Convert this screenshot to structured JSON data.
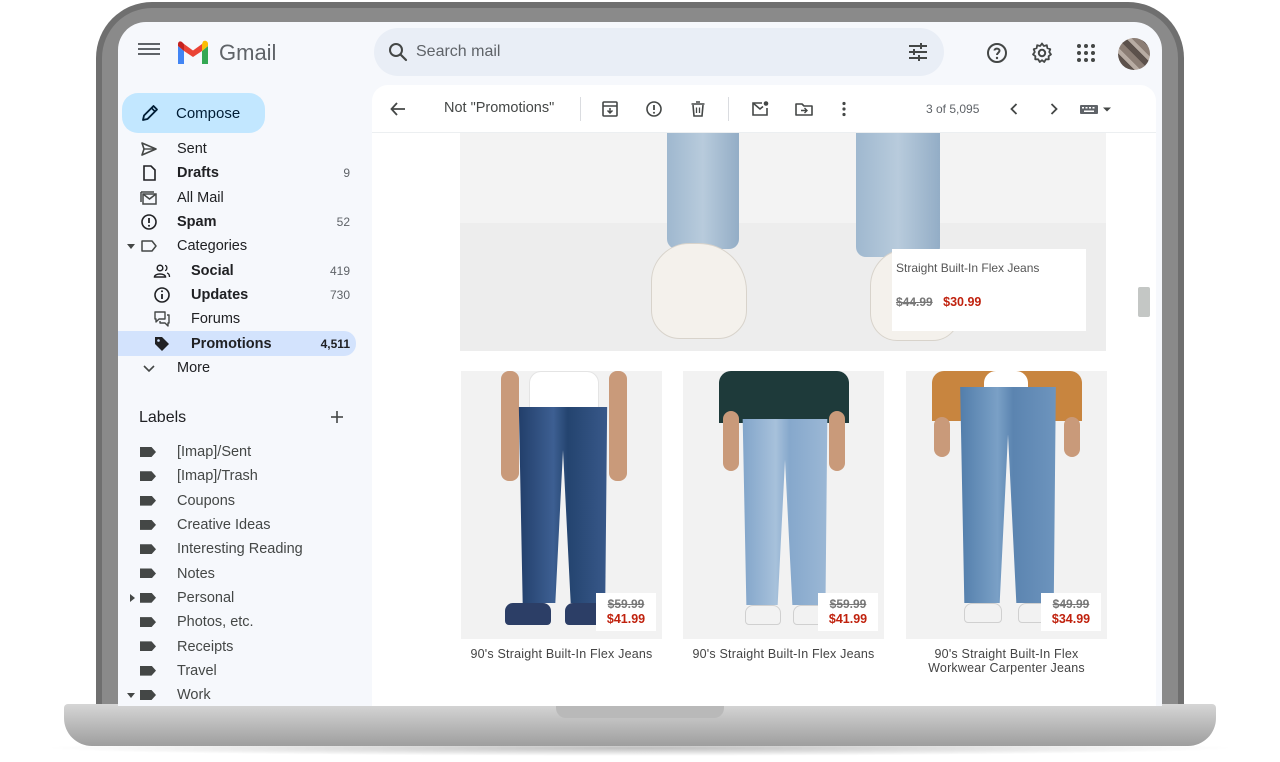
{
  "app": {
    "name": "Gmail"
  },
  "search": {
    "placeholder": "Search mail"
  },
  "sidebar": {
    "compose_label": "Compose",
    "items": [
      {
        "label": "Sent",
        "count": "",
        "icon": "send-icon",
        "bold": false
      },
      {
        "label": "Drafts",
        "count": "9",
        "icon": "draft-icon",
        "bold": true
      },
      {
        "label": "All Mail",
        "count": "",
        "icon": "all-mail-icon",
        "bold": false
      },
      {
        "label": "Spam",
        "count": "52",
        "icon": "spam-icon",
        "bold": true
      },
      {
        "label": "Categories",
        "count": "",
        "icon": "label-outline-icon",
        "bold": false
      },
      {
        "label": "Social",
        "count": "419",
        "icon": "people-icon",
        "bold": true
      },
      {
        "label": "Updates",
        "count": "730",
        "icon": "info-icon",
        "bold": true
      },
      {
        "label": "Forums",
        "count": "",
        "icon": "forum-icon",
        "bold": false
      },
      {
        "label": "Promotions",
        "count": "4,511",
        "icon": "tag-icon",
        "bold": true
      },
      {
        "label": "More",
        "count": "",
        "icon": "chevron-down-icon",
        "bold": false
      }
    ]
  },
  "labels": {
    "header": "Labels",
    "items": [
      "[Imap]/Sent",
      "[Imap]/Trash",
      "Coupons",
      "Creative Ideas",
      "Interesting Reading",
      "Notes",
      "Personal",
      "Photos, etc.",
      "Receipts",
      "Travel",
      "Work"
    ]
  },
  "toolbar": {
    "not_promotions": "Not \"Promotions\"",
    "pagination": "3 of 5,095"
  },
  "email": {
    "hero": {
      "product_name": "Straight Built-In Flex Jeans",
      "old_price": "$44.99",
      "new_price": "$30.99"
    },
    "products": [
      {
        "name": "90's Straight Built-In Flex Jeans",
        "old_price": "$59.99",
        "new_price": "$41.99"
      },
      {
        "name": "90's Straight Built-In Flex Jeans",
        "old_price": "$59.99",
        "new_price": "$41.99"
      },
      {
        "name": "90's Straight Built-In Flex Workwear Carpenter Jeans",
        "old_price": "$49.99",
        "new_price": "$34.99"
      }
    ]
  },
  "colors": {
    "compose_bg": "#c2e7ff",
    "selected_nav_bg": "#d3e3fd",
    "search_bg": "#e9eef6",
    "sale_price": "#c0220e"
  }
}
